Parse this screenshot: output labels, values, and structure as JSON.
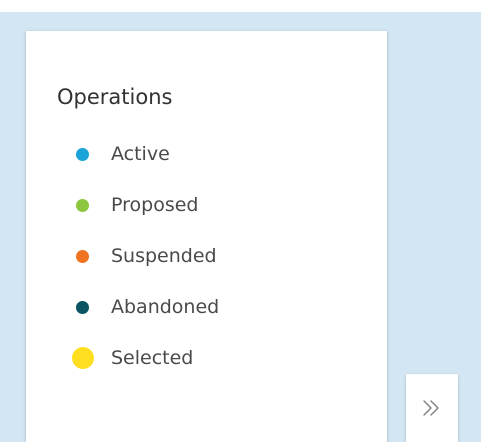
{
  "legend": {
    "title": "Operations",
    "items": [
      {
        "label": "Active",
        "color": "#1aa3d6",
        "size": "small"
      },
      {
        "label": "Proposed",
        "color": "#8cc63f",
        "size": "small"
      },
      {
        "label": "Suspended",
        "color": "#f07322",
        "size": "small"
      },
      {
        "label": "Abandoned",
        "color": "#0b5563",
        "size": "small"
      },
      {
        "label": "Selected",
        "color": "#ffdd1f",
        "size": "large"
      }
    ]
  },
  "map": {
    "background_color": "#d3e6f3"
  },
  "toggle": {
    "icon": "double-chevron-right-icon"
  }
}
